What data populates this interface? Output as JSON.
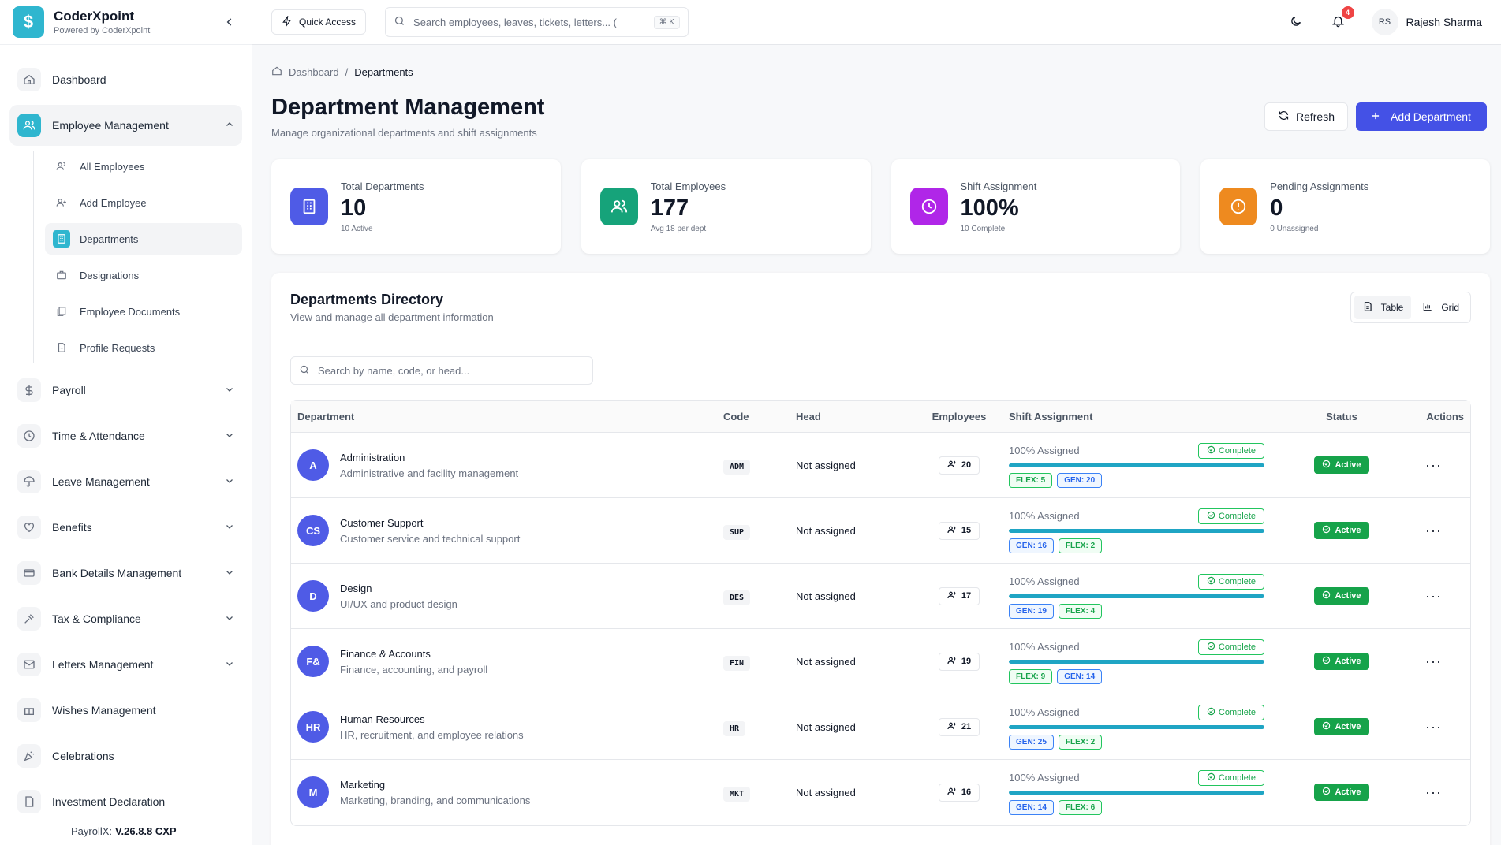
{
  "brand": {
    "name": "CoderXpoint",
    "sub": "Powered by CoderXpoint",
    "logo_glyph": "$"
  },
  "sidebar": {
    "items": [
      {
        "label": "Dashboard",
        "icon": "home-icon"
      },
      {
        "label": "Employee Management",
        "icon": "users-icon",
        "expanded": true
      },
      {
        "label": "Payroll",
        "icon": "dollar-icon"
      },
      {
        "label": "Time & Attendance",
        "icon": "clock-icon"
      },
      {
        "label": "Leave Management",
        "icon": "umbrella-icon"
      },
      {
        "label": "Benefits",
        "icon": "heart-icon"
      },
      {
        "label": "Bank Details Management",
        "icon": "card-icon"
      },
      {
        "label": "Tax & Compliance",
        "icon": "gavel-icon"
      },
      {
        "label": "Letters Management",
        "icon": "mail-icon"
      },
      {
        "label": "Wishes Management",
        "icon": "gift-icon"
      },
      {
        "label": "Celebrations",
        "icon": "party-icon"
      },
      {
        "label": "Investment Declaration",
        "icon": "document-icon"
      }
    ],
    "sub_items": [
      {
        "label": "All Employees"
      },
      {
        "label": "Add Employee"
      },
      {
        "label": "Departments",
        "active": true
      },
      {
        "label": "Designations"
      },
      {
        "label": "Employee Documents"
      },
      {
        "label": "Profile Requests"
      }
    ],
    "footer_prefix": "PayrollX:",
    "footer_version": "V.26.8.8 CXP"
  },
  "header": {
    "quick_access": "Quick Access",
    "search_placeholder": "Search employees, leaves, tickets, letters... (",
    "shortcut": "⌘ K",
    "notif_count": "4",
    "user_initials": "RS",
    "user_name": "Rajesh Sharma"
  },
  "breadcrumb": {
    "home": "Dashboard",
    "sep": "/",
    "current": "Departments"
  },
  "page": {
    "title": "Department Management",
    "subtitle": "Manage organizational departments and shift assignments",
    "refresh": "Refresh",
    "add": "Add Department"
  },
  "stats": [
    {
      "label": "Total Departments",
      "value": "10",
      "note": "10 Active",
      "color": "#4f5be6",
      "icon": "building-icon"
    },
    {
      "label": "Total Employees",
      "value": "177",
      "note": "Avg 18 per dept",
      "color": "#16a37a",
      "icon": "users-icon"
    },
    {
      "label": "Shift Assignment",
      "value": "100%",
      "note": "10 Complete",
      "color": "#b026e8",
      "icon": "clock-icon"
    },
    {
      "label": "Pending Assignments",
      "value": "0",
      "note": "0 Unassigned",
      "color": "#ee8a1f",
      "icon": "alert-icon"
    }
  ],
  "directory": {
    "title": "Departments Directory",
    "subtitle": "View and manage all department information",
    "view_table": "Table",
    "view_grid": "Grid",
    "search_placeholder": "Search by name, code, or head...",
    "columns": [
      "Department",
      "Code",
      "Head",
      "Employees",
      "Shift Assignment",
      "Status",
      "Actions"
    ],
    "rows": [
      {
        "initials": "A",
        "name": "Administration",
        "desc": "Administrative and facility management",
        "code": "ADM",
        "head": "Not assigned",
        "employees": "20",
        "assigned": "100% Assigned",
        "progress": 1.0,
        "complete": "Complete",
        "tags": [
          {
            "t": "FLEX: 5",
            "k": "flex"
          },
          {
            "t": "GEN: 20",
            "k": "gen"
          }
        ],
        "status": "Active",
        "actions": "···"
      },
      {
        "initials": "CS",
        "name": "Customer Support",
        "desc": "Customer service and technical support",
        "code": "SUP",
        "head": "Not assigned",
        "employees": "15",
        "assigned": "100% Assigned",
        "progress": 1.0,
        "complete": "Complete",
        "tags": [
          {
            "t": "GEN: 16",
            "k": "gen"
          },
          {
            "t": "FLEX: 2",
            "k": "flex"
          }
        ],
        "status": "Active",
        "actions": "···"
      },
      {
        "initials": "D",
        "name": "Design",
        "desc": "UI/UX and product design",
        "code": "DES",
        "head": "Not assigned",
        "employees": "17",
        "assigned": "100% Assigned",
        "progress": 1.0,
        "complete": "Complete",
        "tags": [
          {
            "t": "GEN: 19",
            "k": "gen"
          },
          {
            "t": "FLEX: 4",
            "k": "flex"
          }
        ],
        "status": "Active",
        "actions": "···"
      },
      {
        "initials": "F&",
        "name": "Finance & Accounts",
        "desc": "Finance, accounting, and payroll",
        "code": "FIN",
        "head": "Not assigned",
        "employees": "19",
        "assigned": "100% Assigned",
        "progress": 1.0,
        "complete": "Complete",
        "tags": [
          {
            "t": "FLEX: 9",
            "k": "flex"
          },
          {
            "t": "GEN: 14",
            "k": "gen"
          }
        ],
        "status": "Active",
        "actions": "···"
      },
      {
        "initials": "HR",
        "name": "Human Resources",
        "desc": "HR, recruitment, and employee relations",
        "code": "HR",
        "head": "Not assigned",
        "employees": "21",
        "assigned": "100% Assigned",
        "progress": 1.0,
        "complete": "Complete",
        "tags": [
          {
            "t": "GEN: 25",
            "k": "gen"
          },
          {
            "t": "FLEX: 2",
            "k": "flex"
          }
        ],
        "status": "Active",
        "actions": "···"
      },
      {
        "initials": "M",
        "name": "Marketing",
        "desc": "Marketing, branding, and communications",
        "code": "MKT",
        "head": "Not assigned",
        "employees": "16",
        "assigned": "100% Assigned",
        "progress": 1.0,
        "complete": "Complete",
        "tags": [
          {
            "t": "GEN: 14",
            "k": "gen"
          },
          {
            "t": "FLEX: 6",
            "k": "flex"
          }
        ],
        "status": "Active",
        "actions": "···"
      }
    ]
  }
}
